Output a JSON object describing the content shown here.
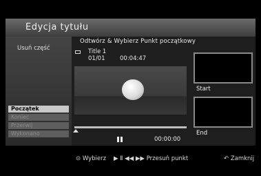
{
  "window": {
    "title": "Edycja tytułu"
  },
  "left_panel": {
    "label": "Usuń część",
    "menu": [
      {
        "label": "Początek",
        "state": "active"
      },
      {
        "label": "Koniec",
        "state": "disabled"
      },
      {
        "label": "Przerwij",
        "state": "disabled"
      },
      {
        "label": "Wykonano",
        "state": "disabled"
      }
    ]
  },
  "main": {
    "header": "Odtwórz & Wybierz Punkt początkowy",
    "title_name": "Title 1",
    "chapter": "01/01",
    "duration": "00:04:47",
    "current_time": "00:00:00",
    "progress_fraction": 0.0
  },
  "thumbnails": {
    "start_label": "Start",
    "end_label": "End"
  },
  "bottom": {
    "select": "Wybierz",
    "move_point": "Przesuń punkt",
    "close": "Zamknij"
  },
  "colors": {
    "background": "#000000",
    "active_menu": "#c8c8c8",
    "disabled_menu": "#5e5e5e"
  }
}
